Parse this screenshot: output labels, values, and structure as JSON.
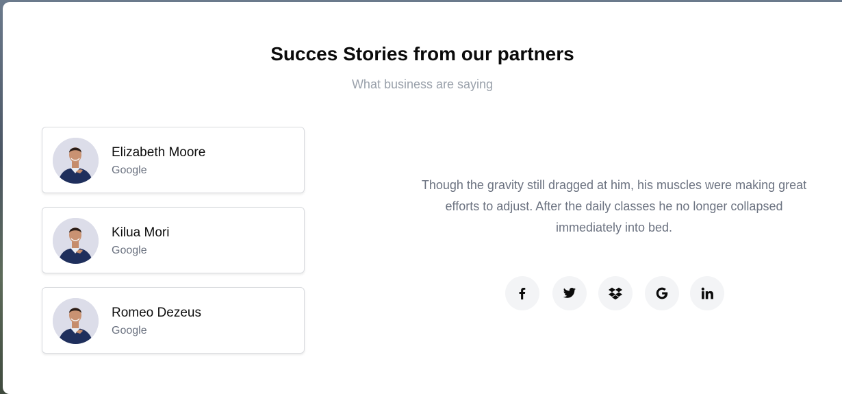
{
  "header": {
    "title": "Succes Stories from our partners",
    "subtitle": "What business are saying"
  },
  "testimonials": [
    {
      "name": "Elizabeth Moore",
      "company": "Google"
    },
    {
      "name": "Kilua Mori",
      "company": "Google"
    },
    {
      "name": "Romeo Dezeus",
      "company": "Google"
    }
  ],
  "quote": {
    "text": "Though the gravity still dragged at him, his muscles were making great efforts to adjust. After the daily classes he no longer collapsed immediately into bed."
  },
  "socials": [
    {
      "icon": "facebook-icon"
    },
    {
      "icon": "twitter-icon"
    },
    {
      "icon": "dropbox-icon"
    },
    {
      "icon": "google-icon"
    },
    {
      "icon": "linkedin-icon"
    }
  ],
  "colors": {
    "title": "#0b0b0b",
    "muted": "#6b7280",
    "subtitle": "#9aa1ab",
    "social_bg": "#f3f4f6"
  }
}
